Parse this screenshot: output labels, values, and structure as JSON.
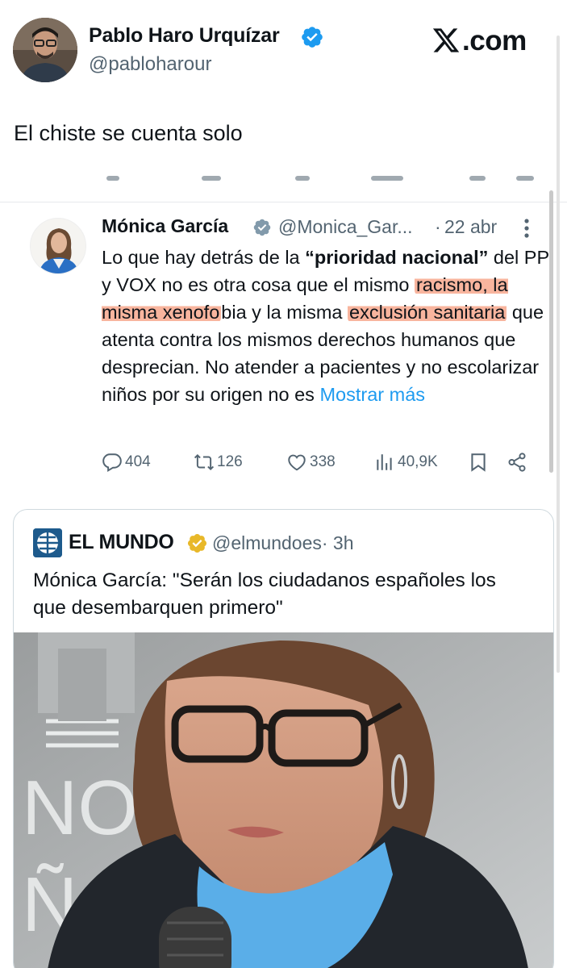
{
  "header": {
    "author_name": "Pablo Haro Urquízar",
    "author_handle": "@pabloharour",
    "site_label": ".com"
  },
  "tweet": {
    "text": "El chiste se cuenta solo"
  },
  "quoted_tweet": {
    "author_name": "Mónica García",
    "author_handle": "@Monica_Gar...",
    "separator": "·",
    "date": "22 abr",
    "body": {
      "p1": "Lo que hay detrás de la ",
      "bold": "“prioridad nacional”",
      "p2": " del PP y VOX no es otra cosa que el mismo ",
      "hl1": "racismo, la misma xenofo",
      "p3": "bia y la misma ",
      "hl2": "exclusión sanitaria",
      "p4": " que atenta contra los mismos derechos humanos que desprecian. No atender a pacientes y no escolarizar niños por su origen no es ",
      "more": "Mostrar más"
    },
    "stats": {
      "replies": "404",
      "retweets": "126",
      "likes": "338",
      "views": "40,9K"
    }
  },
  "nested_quote": {
    "outlet_name": "EL MUNDO",
    "handle": "@elmundoes",
    "time": "· 3h",
    "text": "Mónica García: \"Serán los ciudadanos españoles los que desembarquen primero\""
  },
  "colors": {
    "text": "#0f1419",
    "muted": "#536471",
    "accent": "#1d9bf0",
    "highlight": "#f69878",
    "gold_badge": "#e8b829",
    "el_mundo_blue": "#1d5a8c"
  },
  "icons": [
    "verified-badge-icon",
    "x-logo-icon",
    "more-options-icon",
    "reply-icon",
    "retweet-icon",
    "like-icon",
    "views-icon",
    "bookmark-icon",
    "share-icon",
    "gold-verified-badge-icon",
    "el-mundo-logo-icon"
  ]
}
